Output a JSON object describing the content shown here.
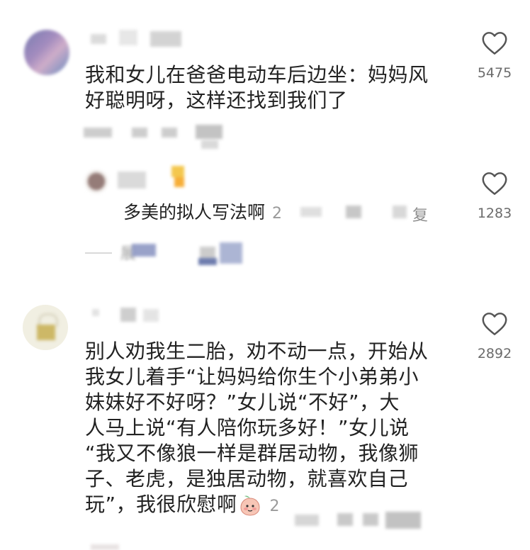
{
  "comments": [
    {
      "text_line1": "我和女儿在爸爸电动车后边坐：妈妈风",
      "text_line2": "好聪明呀，这样还找到我们了",
      "likes": "5475",
      "icon": "heart-icon"
    },
    {
      "reply_text": "多美的拟人写法啊",
      "reply_meta_fragment": "2",
      "reply_tail": "复",
      "likes": "1283",
      "expand_fragment": "展",
      "icon": "heart-icon"
    },
    {
      "lines": [
        "别人劝我生二胎，劝不动一点，开始从",
        "我女儿着手“让妈妈给你生个小弟弟小",
        "妹妹好不好呀？”女儿说“不好”，大",
        "人马上说“有人陪你玩多好！”女儿说",
        "“我又不像狼一样是群居动物，我像狮",
        "子、老虎，是独居动物，就喜欢自己",
        "玩”，我很欣慰啊"
      ],
      "meta_fragment": "2",
      "likes": "2892",
      "icon": "heart-icon",
      "emoji": "blushing-peach-emoji"
    }
  ],
  "colors": {
    "text": "#222222",
    "count": "#6b6b6b",
    "meta": "#9a9a9a",
    "divider": "#d9d9d9"
  }
}
